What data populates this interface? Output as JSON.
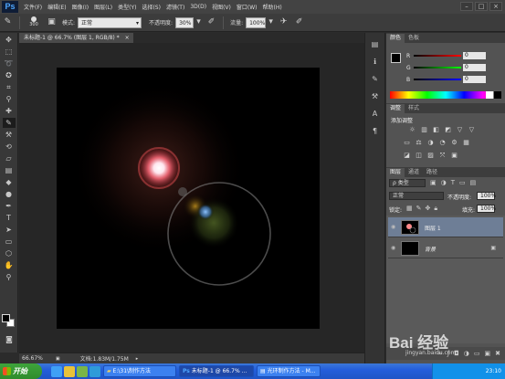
{
  "app": {
    "logo": "Ps",
    "menu": [
      "文件(F)",
      "编辑(E)",
      "图像(I)",
      "图层(L)",
      "类型(Y)",
      "选择(S)",
      "滤镜(T)",
      "3D(D)",
      "视图(V)",
      "窗口(W)",
      "帮助(H)"
    ],
    "window_controls": [
      "–",
      "□",
      "×"
    ]
  },
  "options": {
    "brush_size": "300",
    "mode_label": "模式:",
    "mode_value": "正常",
    "opacity_label": "不透明度:",
    "opacity_value": "30%",
    "flow_label": "流量:",
    "flow_value": "100%"
  },
  "document": {
    "tab_title": "未标题-1 @ 66.7% (图层 1, RGB/8) *",
    "tab_close": "×"
  },
  "status": {
    "zoom": "66.67%",
    "doc_info": "文档:1.83M/1.75M"
  },
  "color_panel": {
    "tabs": [
      "颜色",
      "色板"
    ],
    "channels": [
      {
        "label": "R",
        "value": "0",
        "color": "#c83232"
      },
      {
        "label": "G",
        "value": "0",
        "color": "#32a032"
      },
      {
        "label": "B",
        "value": "0",
        "color": "#3250c8"
      }
    ]
  },
  "adjustments_panel": {
    "tabs": [
      "调整",
      "样式"
    ],
    "add_label": "添加调整",
    "row1_icons": [
      "☼",
      "▥",
      "◧",
      "◩",
      "▽",
      "▽"
    ],
    "row2_icons": [
      "▭",
      "⚖",
      "◑",
      "◔",
      "⚙",
      "▦"
    ],
    "row3_icons": [
      "◪",
      "◫",
      "▨",
      "⤧",
      "▣"
    ]
  },
  "layers_panel": {
    "tabs": [
      "图层",
      "通道",
      "路径"
    ],
    "kind_label": "ρ 类型",
    "blend_mode": "正常",
    "opacity_label": "不透明度:",
    "opacity_value": "100%",
    "lock_label": "锁定:",
    "fill_label": "填充:",
    "fill_value": "100%",
    "layers": [
      {
        "name": "图层 1"
      },
      {
        "name": "背景"
      }
    ]
  },
  "taskbar": {
    "start_label": "开始",
    "tasks": [
      "E:\\31\\制作方法",
      "未标题-1 @ 66.7% ...",
      "光环制作方法 - M..."
    ],
    "clock": "23:10"
  },
  "watermark": {
    "text": "Bai 经验",
    "subtext": "jingyan.baidu.com"
  }
}
